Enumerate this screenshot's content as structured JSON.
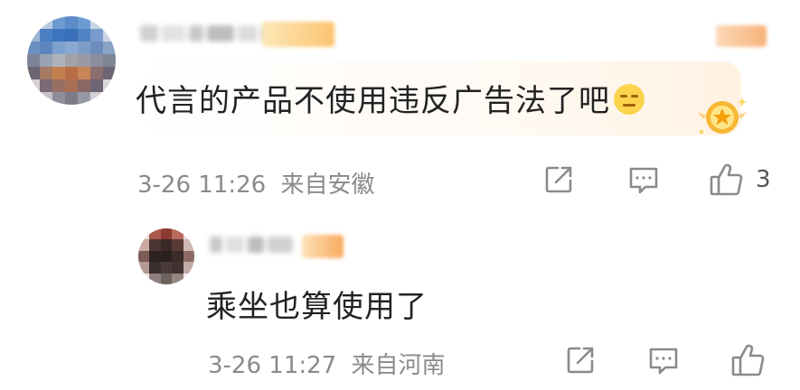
{
  "comment": {
    "text": "代言的产品不使用违反广告法了吧",
    "emoji_icon": "thinking-face-icon",
    "timestamp": "3-26 11:26",
    "location": "来自安徽",
    "like_count": "3",
    "badge_icon": "crown-medal-icon"
  },
  "reply": {
    "text": "乘坐也算使用了",
    "timestamp": "3-26 11:27",
    "location": "来自河南"
  },
  "colors": {
    "accent_badge": "#fbbf6a",
    "meta_text": "#8a8a8a",
    "icon_stroke": "#8a8a8a"
  }
}
